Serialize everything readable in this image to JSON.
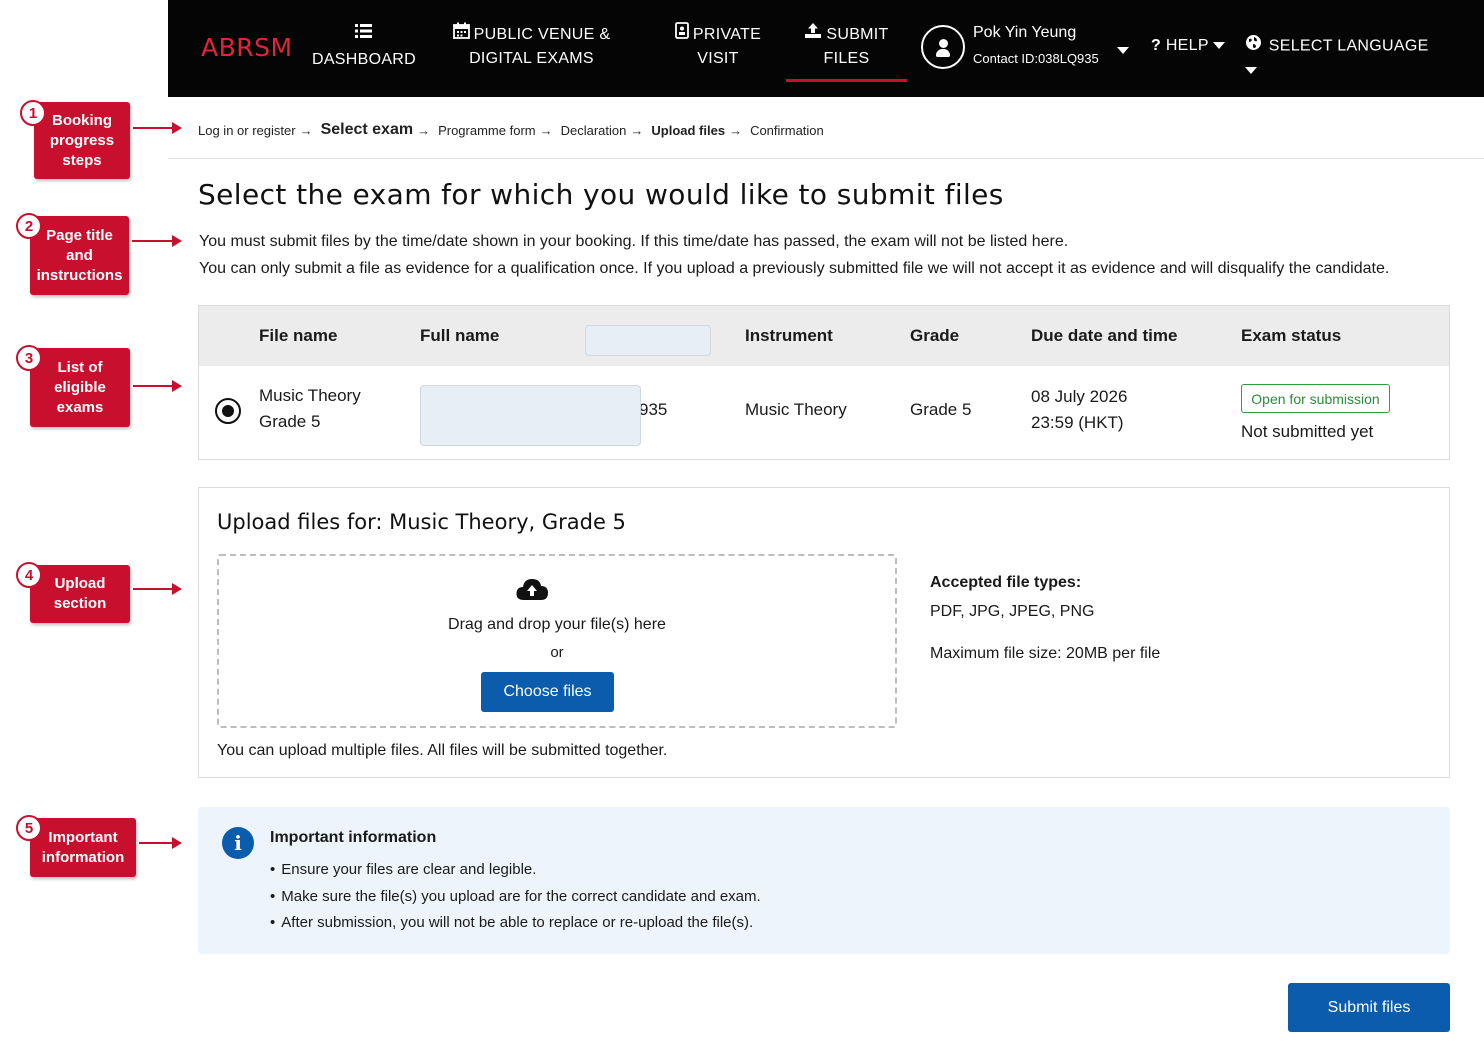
{
  "annotations": [
    {
      "num": "1",
      "label": "Booking progress steps"
    },
    {
      "num": "2",
      "label": "Page title and instructions"
    },
    {
      "num": "3",
      "label": "List of eligible exams"
    },
    {
      "num": "4",
      "label": "Upload section"
    },
    {
      "num": "5",
      "label": "Important information"
    }
  ],
  "nav": {
    "logo": "ABRSM",
    "items": [
      {
        "line1": "DASHBOARD",
        "line2": "",
        "icon": "list-icon"
      },
      {
        "line1": "PUBLIC VENUE &",
        "line2": "DIGITAL EXAMS",
        "icon": "calendar-icon"
      },
      {
        "line1": "PRIVATE",
        "line2": "VISIT",
        "icon": "badge-icon"
      },
      {
        "line1": "SUBMIT",
        "line2": "FILES",
        "icon": "upload-icon"
      }
    ],
    "user_name": "Pok Yin Yeung",
    "contact_id": "Contact ID:038LQ935",
    "help": "HELP",
    "language": "SELECT LANGUAGE",
    "accent_color": "#c8102e"
  },
  "breadcrumb": [
    "Log in or register",
    "Select exam",
    "Programme form",
    "Declaration",
    "Upload files",
    "Confirmation"
  ],
  "page": {
    "title": "Select the exam for which you would like to submit files",
    "instruction_1": "You must submit files by the time/date shown in your booking. If this time/date has passed, the exam will not be listed here.",
    "instruction_2": "You can only submit a file as evidence for a qualification once. If you upload a previously submitted file we will not accept it as evidence and will disqualify the candidate."
  },
  "table": {
    "headers": [
      "File name",
      "Full name",
      "Instrument",
      "Grade",
      "Due date and time",
      "Exam status"
    ],
    "row": {
      "file_name_1": "Music Theory",
      "file_name_2": "Grade 5",
      "id_fragment": "935",
      "instrument": "Music Theory",
      "grade": "Grade 5",
      "due_date": "08 July 2026",
      "due_time": "23:59 (HKT)",
      "status_badge": "Open for submission",
      "status_text": "Not submitted yet"
    }
  },
  "upload": {
    "title": "Upload files for: Music Theory, Grade 5",
    "drag_text": "Drag and drop your file(s) here",
    "or": "or",
    "choose_button": "Choose files",
    "note": "You can upload multiple files. All files will be submitted together.",
    "accepted_title": "Accepted file types:",
    "accepted_types": "PDF, JPG, JPEG, PNG",
    "max_size": "Maximum file size: 20MB per file"
  },
  "info": {
    "title": "Important information",
    "items": [
      "Ensure your files are clear and legible.",
      "Make sure the file(s) you upload are for the correct candidate and exam.",
      "After submission, you will not be able to replace or re-upload the file(s)."
    ]
  },
  "submit_button": "Submit files"
}
